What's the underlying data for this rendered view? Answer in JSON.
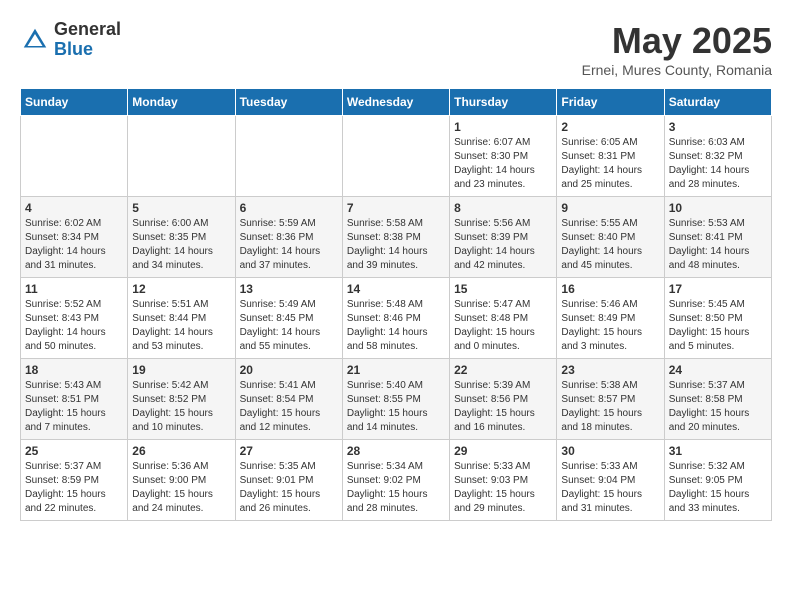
{
  "header": {
    "logo_general": "General",
    "logo_blue": "Blue",
    "month_title": "May 2025",
    "subtitle": "Ernei, Mures County, Romania"
  },
  "days_of_week": [
    "Sunday",
    "Monday",
    "Tuesday",
    "Wednesday",
    "Thursday",
    "Friday",
    "Saturday"
  ],
  "weeks": [
    [
      {
        "day": "",
        "info": ""
      },
      {
        "day": "",
        "info": ""
      },
      {
        "day": "",
        "info": ""
      },
      {
        "day": "",
        "info": ""
      },
      {
        "day": "1",
        "info": "Sunrise: 6:07 AM\nSunset: 8:30 PM\nDaylight: 14 hours\nand 23 minutes."
      },
      {
        "day": "2",
        "info": "Sunrise: 6:05 AM\nSunset: 8:31 PM\nDaylight: 14 hours\nand 25 minutes."
      },
      {
        "day": "3",
        "info": "Sunrise: 6:03 AM\nSunset: 8:32 PM\nDaylight: 14 hours\nand 28 minutes."
      }
    ],
    [
      {
        "day": "4",
        "info": "Sunrise: 6:02 AM\nSunset: 8:34 PM\nDaylight: 14 hours\nand 31 minutes."
      },
      {
        "day": "5",
        "info": "Sunrise: 6:00 AM\nSunset: 8:35 PM\nDaylight: 14 hours\nand 34 minutes."
      },
      {
        "day": "6",
        "info": "Sunrise: 5:59 AM\nSunset: 8:36 PM\nDaylight: 14 hours\nand 37 minutes."
      },
      {
        "day": "7",
        "info": "Sunrise: 5:58 AM\nSunset: 8:38 PM\nDaylight: 14 hours\nand 39 minutes."
      },
      {
        "day": "8",
        "info": "Sunrise: 5:56 AM\nSunset: 8:39 PM\nDaylight: 14 hours\nand 42 minutes."
      },
      {
        "day": "9",
        "info": "Sunrise: 5:55 AM\nSunset: 8:40 PM\nDaylight: 14 hours\nand 45 minutes."
      },
      {
        "day": "10",
        "info": "Sunrise: 5:53 AM\nSunset: 8:41 PM\nDaylight: 14 hours\nand 48 minutes."
      }
    ],
    [
      {
        "day": "11",
        "info": "Sunrise: 5:52 AM\nSunset: 8:43 PM\nDaylight: 14 hours\nand 50 minutes."
      },
      {
        "day": "12",
        "info": "Sunrise: 5:51 AM\nSunset: 8:44 PM\nDaylight: 14 hours\nand 53 minutes."
      },
      {
        "day": "13",
        "info": "Sunrise: 5:49 AM\nSunset: 8:45 PM\nDaylight: 14 hours\nand 55 minutes."
      },
      {
        "day": "14",
        "info": "Sunrise: 5:48 AM\nSunset: 8:46 PM\nDaylight: 14 hours\nand 58 minutes."
      },
      {
        "day": "15",
        "info": "Sunrise: 5:47 AM\nSunset: 8:48 PM\nDaylight: 15 hours\nand 0 minutes."
      },
      {
        "day": "16",
        "info": "Sunrise: 5:46 AM\nSunset: 8:49 PM\nDaylight: 15 hours\nand 3 minutes."
      },
      {
        "day": "17",
        "info": "Sunrise: 5:45 AM\nSunset: 8:50 PM\nDaylight: 15 hours\nand 5 minutes."
      }
    ],
    [
      {
        "day": "18",
        "info": "Sunrise: 5:43 AM\nSunset: 8:51 PM\nDaylight: 15 hours\nand 7 minutes."
      },
      {
        "day": "19",
        "info": "Sunrise: 5:42 AM\nSunset: 8:52 PM\nDaylight: 15 hours\nand 10 minutes."
      },
      {
        "day": "20",
        "info": "Sunrise: 5:41 AM\nSunset: 8:54 PM\nDaylight: 15 hours\nand 12 minutes."
      },
      {
        "day": "21",
        "info": "Sunrise: 5:40 AM\nSunset: 8:55 PM\nDaylight: 15 hours\nand 14 minutes."
      },
      {
        "day": "22",
        "info": "Sunrise: 5:39 AM\nSunset: 8:56 PM\nDaylight: 15 hours\nand 16 minutes."
      },
      {
        "day": "23",
        "info": "Sunrise: 5:38 AM\nSunset: 8:57 PM\nDaylight: 15 hours\nand 18 minutes."
      },
      {
        "day": "24",
        "info": "Sunrise: 5:37 AM\nSunset: 8:58 PM\nDaylight: 15 hours\nand 20 minutes."
      }
    ],
    [
      {
        "day": "25",
        "info": "Sunrise: 5:37 AM\nSunset: 8:59 PM\nDaylight: 15 hours\nand 22 minutes."
      },
      {
        "day": "26",
        "info": "Sunrise: 5:36 AM\nSunset: 9:00 PM\nDaylight: 15 hours\nand 24 minutes."
      },
      {
        "day": "27",
        "info": "Sunrise: 5:35 AM\nSunset: 9:01 PM\nDaylight: 15 hours\nand 26 minutes."
      },
      {
        "day": "28",
        "info": "Sunrise: 5:34 AM\nSunset: 9:02 PM\nDaylight: 15 hours\nand 28 minutes."
      },
      {
        "day": "29",
        "info": "Sunrise: 5:33 AM\nSunset: 9:03 PM\nDaylight: 15 hours\nand 29 minutes."
      },
      {
        "day": "30",
        "info": "Sunrise: 5:33 AM\nSunset: 9:04 PM\nDaylight: 15 hours\nand 31 minutes."
      },
      {
        "day": "31",
        "info": "Sunrise: 5:32 AM\nSunset: 9:05 PM\nDaylight: 15 hours\nand 33 minutes."
      }
    ]
  ]
}
